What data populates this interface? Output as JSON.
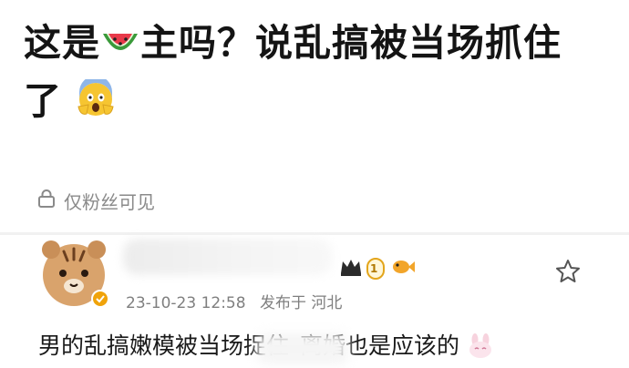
{
  "post": {
    "title_part1": "这是",
    "title_part2": "主吗？说乱搞被当场抓住",
    "title_part3": "了"
  },
  "visibility": {
    "label": "仅粉丝可见",
    "icon": "lock-icon"
  },
  "comment": {
    "avatar_icon": "tiger-avatar",
    "badge_level": "1",
    "timestamp": "23-10-23 12:58",
    "location": "发布于 河北",
    "text_before": "男的乱搞嫩模被当场捉住",
    "text_after": "离婚也是应该的",
    "favorite_icon": "star-icon"
  },
  "colors": {
    "title": "#141414",
    "meta": "#7f7f7f",
    "badge_gold": "#e3a51b"
  }
}
